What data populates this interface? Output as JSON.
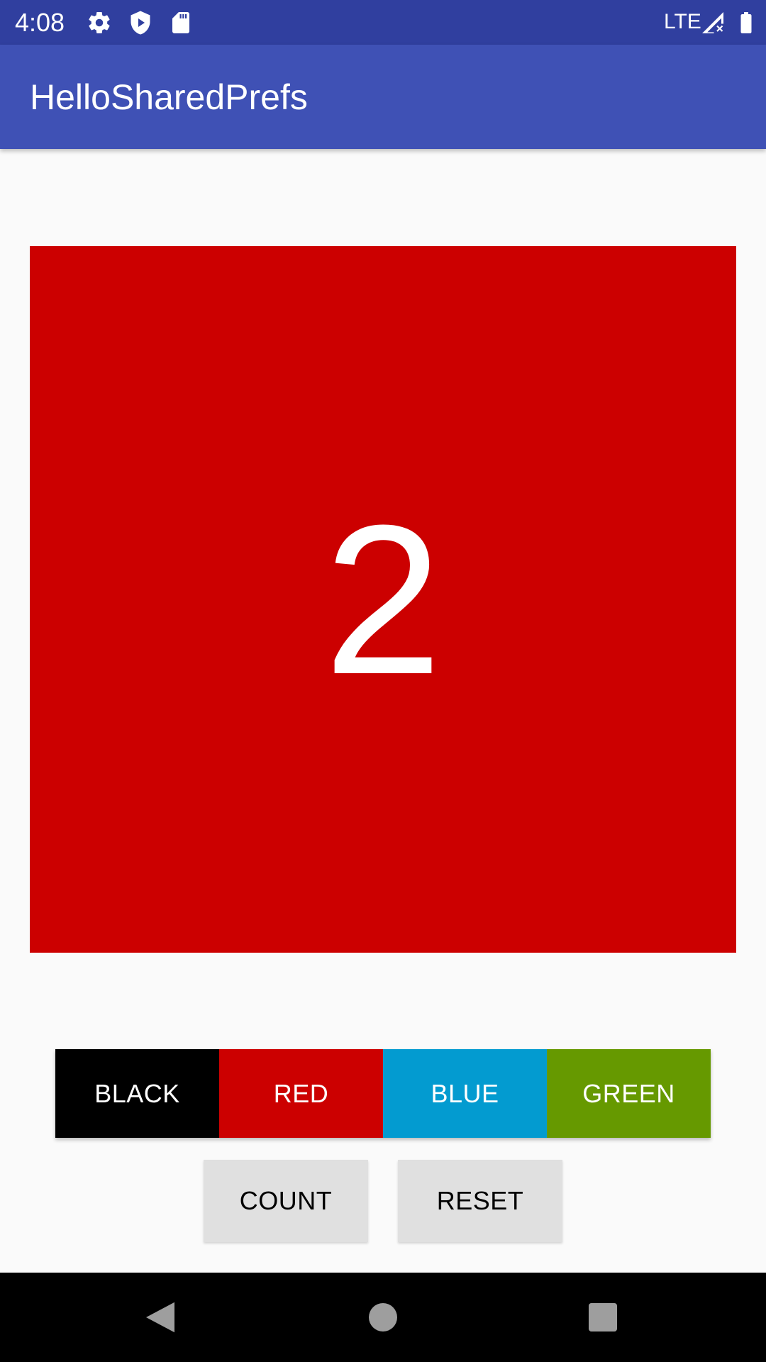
{
  "status_bar": {
    "time": "4:08",
    "network": "LTE",
    "background_color": "#303f9f",
    "icons": [
      "settings-icon",
      "shield-play-icon",
      "sd-card-icon",
      "signal-no-data-icon",
      "battery-icon"
    ]
  },
  "app_bar": {
    "title": "HelloSharedPrefs",
    "background_color": "#3f51b5"
  },
  "count_panel": {
    "count": "2",
    "background_color": "#cc0000"
  },
  "color_buttons": [
    {
      "label": "BLACK",
      "color": "#000000"
    },
    {
      "label": "RED",
      "color": "#cc0000"
    },
    {
      "label": "BLUE",
      "color": "#039bd0"
    },
    {
      "label": "GREEN",
      "color": "#669900"
    }
  ],
  "action_buttons": {
    "count_label": "COUNT",
    "reset_label": "RESET"
  },
  "nav_bar": {
    "icons": [
      "back-icon",
      "home-icon",
      "recents-icon"
    ]
  }
}
